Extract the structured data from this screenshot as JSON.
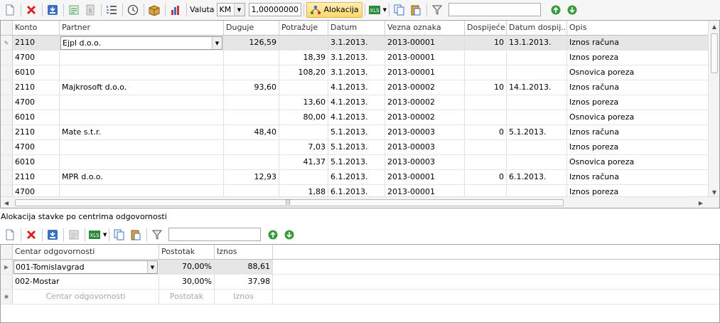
{
  "toolbar": {
    "currency_label": "Valuta",
    "currency_value": "KM",
    "rate_value": "1,00000000",
    "allocation_label": "Alokacija",
    "search_value": ""
  },
  "journal": {
    "columns": [
      "Konto",
      "Partner",
      "Duguje",
      "Potražuje",
      "Datum",
      "Vezna oznaka",
      "Dospijeće",
      "Datum dospij...",
      "Opis"
    ],
    "rows": [
      {
        "konto": "2110",
        "partner": "Ejpl d.o.o.",
        "duguje": "126,59",
        "potrazuje": "",
        "datum": "3.1.2013.",
        "vezna": "2013-00001",
        "dospijece": "10",
        "datum_dosp": "13.1.2013.",
        "opis": "Iznos računa"
      },
      {
        "konto": "4700",
        "partner": "",
        "duguje": "",
        "potrazuje": "18,39",
        "datum": "3.1.2013.",
        "vezna": "2013-00001",
        "dospijece": "",
        "datum_dosp": "",
        "opis": "Iznos poreza"
      },
      {
        "konto": "6010",
        "partner": "",
        "duguje": "",
        "potrazuje": "108,20",
        "datum": "3.1.2013.",
        "vezna": "2013-00001",
        "dospijece": "",
        "datum_dosp": "",
        "opis": "Osnovica poreza"
      },
      {
        "konto": "2110",
        "partner": "Majkrosoft d.o.o.",
        "duguje": "93,60",
        "potrazuje": "",
        "datum": "4.1.2013.",
        "vezna": "2013-00002",
        "dospijece": "10",
        "datum_dosp": "14.1.2013.",
        "opis": "Iznos računa"
      },
      {
        "konto": "4700",
        "partner": "",
        "duguje": "",
        "potrazuje": "13,60",
        "datum": "4.1.2013.",
        "vezna": "2013-00002",
        "dospijece": "",
        "datum_dosp": "",
        "opis": "Iznos poreza"
      },
      {
        "konto": "6010",
        "partner": "",
        "duguje": "",
        "potrazuje": "80,00",
        "datum": "4.1.2013.",
        "vezna": "2013-00002",
        "dospijece": "",
        "datum_dosp": "",
        "opis": "Osnovica poreza"
      },
      {
        "konto": "2110",
        "partner": "Mate s.t.r.",
        "duguje": "48,40",
        "potrazuje": "",
        "datum": "5.1.2013.",
        "vezna": "2013-00003",
        "dospijece": "0",
        "datum_dosp": "5.1.2013.",
        "opis": "Iznos računa"
      },
      {
        "konto": "4700",
        "partner": "",
        "duguje": "",
        "potrazuje": "7,03",
        "datum": "5.1.2013.",
        "vezna": "2013-00003",
        "dospijece": "",
        "datum_dosp": "",
        "opis": "Iznos poreza"
      },
      {
        "konto": "6010",
        "partner": "",
        "duguje": "",
        "potrazuje": "41,37",
        "datum": "5.1.2013.",
        "vezna": "2013-00003",
        "dospijece": "",
        "datum_dosp": "",
        "opis": "Osnovica poreza"
      },
      {
        "konto": "2110",
        "partner": "MPR d.o.o.",
        "duguje": "12,93",
        "potrazuje": "",
        "datum": "6.1.2013.",
        "vezna": "2013-00001",
        "dospijece": "0",
        "datum_dosp": "6.1.2013.",
        "opis": "Iznos računa"
      },
      {
        "konto": "4700",
        "partner": "",
        "duguje": "",
        "potrazuje": "1,88",
        "datum": "6.1.2013.",
        "vezna": "2013-00001",
        "dospijece": "",
        "datum_dosp": "",
        "opis": "Iznos poreza"
      }
    ]
  },
  "allocation": {
    "caption": "Alokacija stavke po centrima odgovornosti",
    "search_value": "",
    "columns": [
      "Centar odgovornosti",
      "Postotak",
      "Iznos"
    ],
    "rows": [
      {
        "centar": "001-Tomislavgrad",
        "postotak": "70,00%",
        "iznos": "88,61"
      },
      {
        "centar": "002-Mostar",
        "postotak": "30,00%",
        "iznos": "37,98"
      }
    ],
    "new_row": [
      "Centar odgovornosti",
      "Postotak",
      "Iznos"
    ]
  }
}
